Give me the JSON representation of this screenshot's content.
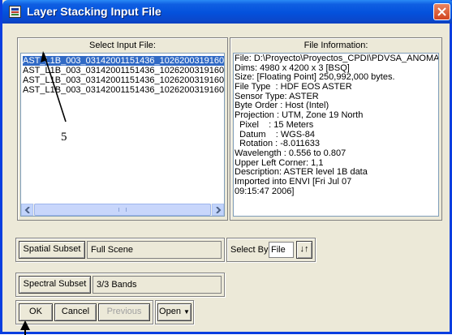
{
  "window": {
    "title": "Layer Stacking Input File"
  },
  "select_input": {
    "header": "Select Input File:",
    "files": [
      "AST_L1B_003_03142001151436_1026200319160",
      "AST_L1B_003_03142001151436_1026200319160",
      "AST_L1B_003_03142001151436_1026200319160",
      "AST_L1B_003_03142001151436_1026200319160"
    ],
    "selected_index": 0
  },
  "file_info": {
    "header": "File Information:",
    "lines": [
      "File: D:\\Proyecto\\Proyectos_CPDI\\PDVSA_ANOMA",
      "Dims: 4980 x 4200 x 3 [BSQ]",
      "Size: [Floating Point] 250,992,000 bytes.",
      "File Type  : HDF EOS ASTER",
      "Sensor Type: ASTER",
      "Byte Order : Host (Intel)",
      "Projection : UTM, Zone 19 North",
      "  Pixel    : 15 Meters",
      "  Datum    : WGS-84",
      "  Rotation : -8.011633",
      "Wavelength : 0.556 to 0.807",
      "Upper Left Corner: 1,1",
      "Description: ASTER level 1B data",
      "Imported into ENVI [Fri Jul 07",
      "09:15:47 2006]"
    ]
  },
  "spatial": {
    "button_label": "Spatial Subset",
    "value": "Full Scene"
  },
  "select_by": {
    "label": "Select By",
    "value": "File",
    "toggle_glyph": "↓↑"
  },
  "spectral": {
    "button_label": "Spectral Subset",
    "value": "3/3 Bands"
  },
  "buttons": {
    "ok": "OK",
    "cancel": "Cancel",
    "previous": "Previous",
    "open": "Open"
  },
  "annotation": {
    "label": "5"
  },
  "colors": {
    "titlebar": "#0451dc",
    "selection": "#316ac5",
    "close": "#d2441f",
    "face": "#ece9d8"
  }
}
